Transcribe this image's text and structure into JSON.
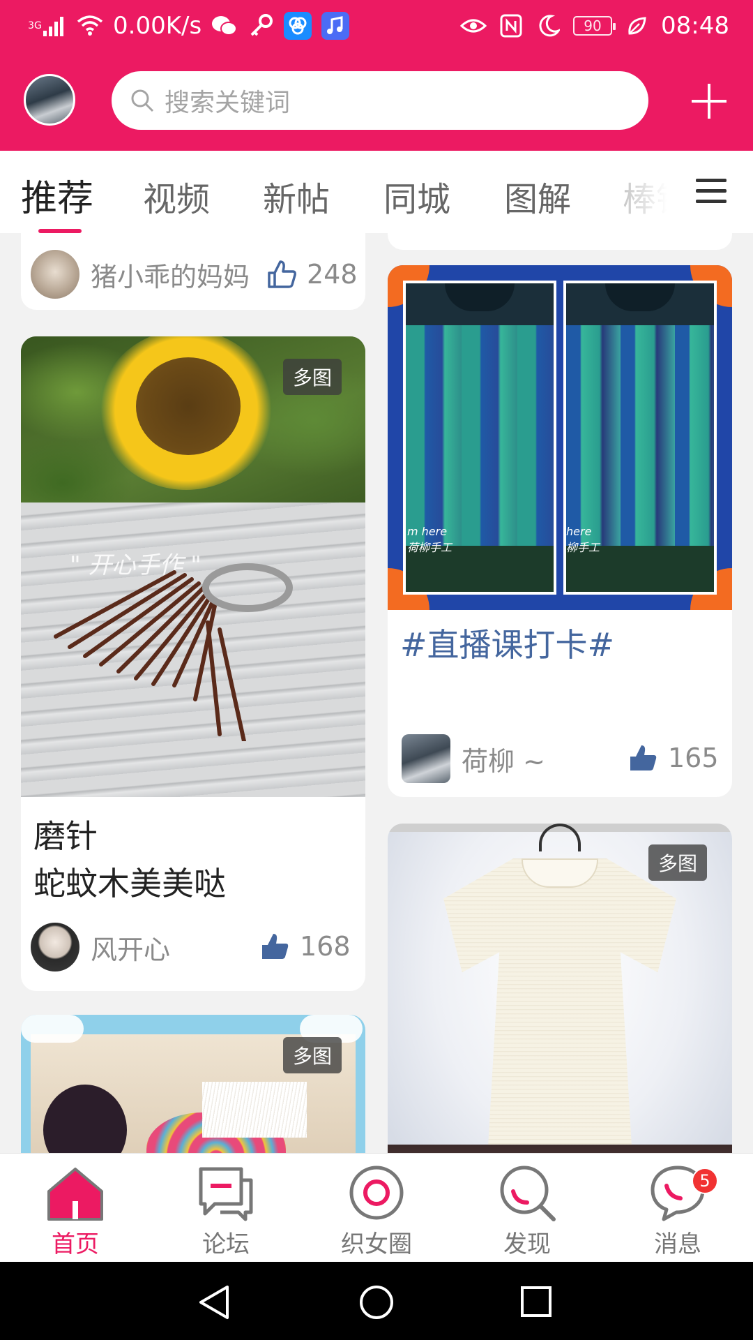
{
  "status_bar": {
    "network_type": "3G",
    "speed": "0.00K/s",
    "battery": "90",
    "time": "08:48"
  },
  "header": {
    "search_placeholder": "搜索关键词",
    "brand_color": "#ec1a62"
  },
  "tabs": [
    {
      "label": "推荐",
      "active": true
    },
    {
      "label": "视频"
    },
    {
      "label": "新帖"
    },
    {
      "label": "同城"
    },
    {
      "label": "图解"
    },
    {
      "label": "棒针"
    }
  ],
  "feed": {
    "left": [
      {
        "user": "猪小乖的妈妈",
        "likes": "248"
      },
      {
        "badge": "多图",
        "title_line1": "磨针",
        "title_line2": "蛇蚊木美美哒",
        "user": "风开心",
        "likes": "168"
      },
      {
        "badge": "多图"
      }
    ],
    "right": [
      {
        "title": "#直播课打卡#",
        "user": "荷柳 ~",
        "likes": "165"
      },
      {
        "badge": "多图"
      }
    ]
  },
  "bottom_nav": [
    {
      "label": "首页",
      "icon": "home-icon",
      "active": true
    },
    {
      "label": "论坛",
      "icon": "forum-icon"
    },
    {
      "label": "织女圈",
      "icon": "circle-icon"
    },
    {
      "label": "发现",
      "icon": "discover-icon"
    },
    {
      "label": "消息",
      "icon": "message-icon",
      "badge": "5"
    }
  ]
}
